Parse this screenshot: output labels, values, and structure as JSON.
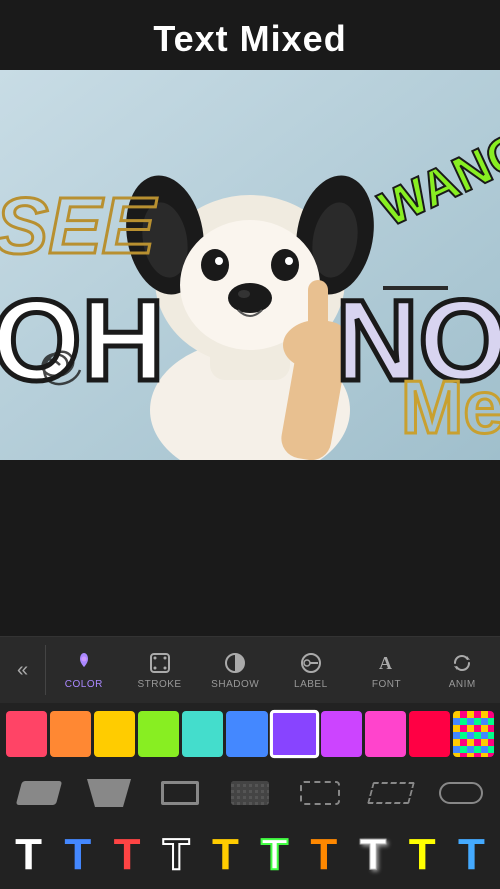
{
  "header": {
    "title": "Text Mixed"
  },
  "canvas": {
    "texts": {
      "see": "SEE",
      "oh": "OH",
      "no": "NO",
      "wang": "WANG",
      "me": "Me"
    }
  },
  "toolbar": {
    "back_icon": "«",
    "items": [
      {
        "id": "color",
        "label": "COLOR",
        "icon": "droplet",
        "active": true
      },
      {
        "id": "stroke",
        "label": "STROKE",
        "icon": "stroke",
        "active": false
      },
      {
        "id": "shadow",
        "label": "SHADOW",
        "icon": "shadow",
        "active": false
      },
      {
        "id": "label",
        "label": "LABEL",
        "icon": "label",
        "active": false
      },
      {
        "id": "font",
        "label": "FONT",
        "icon": "font",
        "active": false
      },
      {
        "id": "anim",
        "label": "ANIM",
        "icon": "anim",
        "active": false
      }
    ]
  },
  "colors": [
    {
      "id": "c1",
      "color": "#ff4466",
      "active": false
    },
    {
      "id": "c2",
      "color": "#ff6644",
      "active": false
    },
    {
      "id": "c3",
      "color": "#ffcc00",
      "active": false
    },
    {
      "id": "c4",
      "color": "#88ff44",
      "active": false
    },
    {
      "id": "c5",
      "color": "#44ffcc",
      "active": false
    },
    {
      "id": "c6",
      "color": "#4488ff",
      "active": false
    },
    {
      "id": "c7",
      "color": "#8844ff",
      "active": true
    },
    {
      "id": "c8",
      "color": "#cc44ff",
      "active": false
    },
    {
      "id": "c9",
      "color": "#ff44cc",
      "active": false
    },
    {
      "id": "c10",
      "color": "#ff0044",
      "active": false
    },
    {
      "id": "c11",
      "color": "checker",
      "active": false
    }
  ],
  "shapes": [
    {
      "id": "s1",
      "type": "parallelogram"
    },
    {
      "id": "s2",
      "type": "trapezoid"
    },
    {
      "id": "s3",
      "type": "rect"
    },
    {
      "id": "s4",
      "type": "rect-dotted"
    },
    {
      "id": "s5",
      "type": "rect-rounded-dashed"
    },
    {
      "id": "s6",
      "type": "parallelogram-outline"
    },
    {
      "id": "s7",
      "type": "pill"
    }
  ],
  "text_styles": [
    {
      "id": "t1",
      "char": "T",
      "color": "#ffffff",
      "stroke": "#ffffff"
    },
    {
      "id": "t2",
      "char": "T",
      "color": "#4488ff",
      "stroke": "#4488ff"
    },
    {
      "id": "t3",
      "char": "T",
      "color": "#ff4444",
      "stroke": "#ff4444"
    },
    {
      "id": "t4",
      "char": "T",
      "color": "#222222",
      "stroke": "#ffffff"
    },
    {
      "id": "t5",
      "char": "T",
      "color": "#ffcc00",
      "stroke": "#ffcc00"
    },
    {
      "id": "t6",
      "char": "T",
      "color": "#ffffff",
      "stroke": "#44ff44"
    },
    {
      "id": "t7",
      "char": "T",
      "color": "#ff8800",
      "stroke": "#ff8800"
    },
    {
      "id": "t8",
      "char": "T",
      "color": "#ffffff",
      "stroke": "#aaaaaa"
    },
    {
      "id": "t9",
      "char": "T",
      "color": "#ffff00",
      "stroke": "#ffff00"
    },
    {
      "id": "t10",
      "char": "T",
      "color": "#44aaff",
      "stroke": "#44aaff"
    }
  ]
}
